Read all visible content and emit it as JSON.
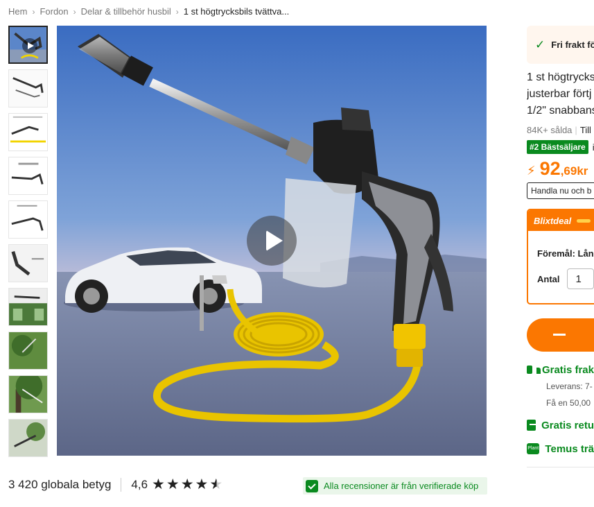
{
  "breadcrumb": [
    "Hem",
    "Fordon",
    "Delar & tillbehör husbil",
    "1 st högtrycksbils tvättva..."
  ],
  "gallery": {
    "thumbnails": [
      {
        "kind": "video",
        "active": true
      },
      {
        "kind": "image"
      },
      {
        "kind": "image"
      },
      {
        "kind": "image"
      },
      {
        "kind": "image"
      },
      {
        "kind": "image"
      },
      {
        "kind": "image"
      },
      {
        "kind": "image"
      },
      {
        "kind": "image"
      },
      {
        "kind": "image"
      }
    ],
    "main_media": "video",
    "play_icon": "play-icon"
  },
  "ratings": {
    "count_label": "3 420 globala betyg",
    "score": "4,6",
    "stars": 4.6,
    "verified_text": "Alla recensioner är från verifierade köp"
  },
  "product": {
    "free_shipping": "Fri frakt fö",
    "title_lines": [
      "1 st högtrycks",
      "justerbar förtj",
      "1/2\" snabbans"
    ],
    "sold": "84K+ sålda",
    "sold_extra": "Till",
    "bestseller_badge": "#2 Bästsäljare",
    "bestseller_cat": "i D",
    "price_int": "92",
    "price_dec": ",69kr",
    "shop_now": "Handla nu och b",
    "flash_title": "Blixtdeal",
    "item_label": "Föremål: Lång",
    "qty_label": "Antal",
    "qty_value": "1"
  },
  "services": [
    {
      "icon": "truck-icon",
      "label": "Gratis frak",
      "subs": [
        "Leverans: 7-",
        "Få en 50,00"
      ]
    },
    {
      "icon": "return-icon",
      "label": "Gratis retu",
      "subs": []
    },
    {
      "icon": "plant-icon",
      "label": "Temus trä",
      "icon_text": "Plant",
      "subs": []
    }
  ],
  "colors": {
    "accent": "#fb7701",
    "green": "#0a8a1f"
  }
}
